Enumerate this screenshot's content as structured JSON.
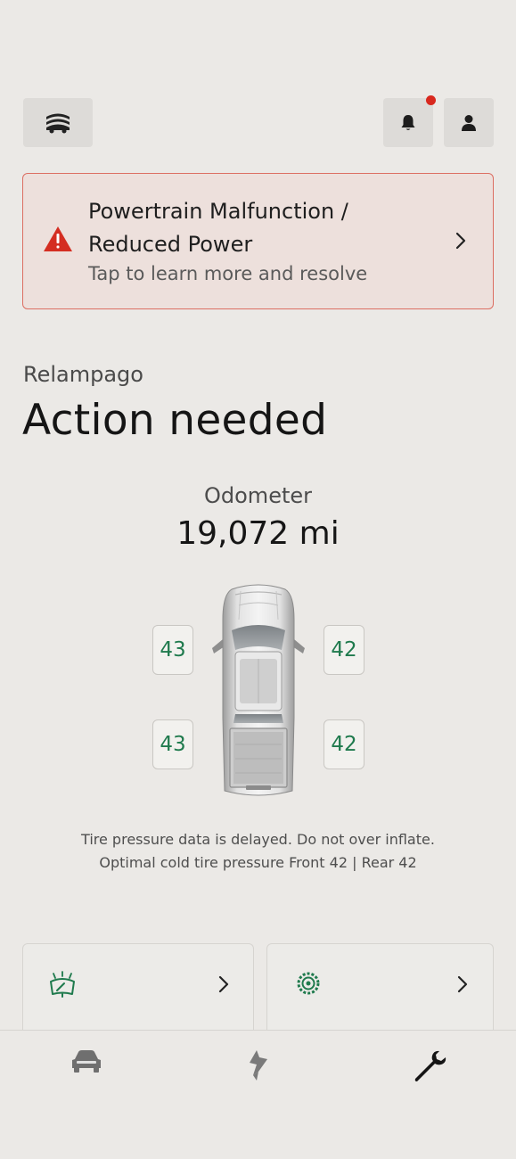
{
  "header": {
    "menu_icon": "garage-stack-icon",
    "bell_icon": "bell-icon",
    "user_icon": "person-icon",
    "notification_dot_color": "#d8281e"
  },
  "alert": {
    "title": "Powertrain Malfunction / Reduced Power",
    "subtitle": "Tap to learn more and resolve",
    "icon": "warning-triangle-icon",
    "icon_color": "#d42e22"
  },
  "vehicle": {
    "name": "Relampago",
    "status": "Action needed"
  },
  "odometer": {
    "label": "Odometer",
    "value": "19,072 mi"
  },
  "tires": {
    "front_left": "43",
    "front_right": "42",
    "rear_left": "43",
    "rear_right": "42",
    "value_color": "#1f7a4d"
  },
  "tire_note": {
    "line1": "Tire pressure data is delayed. Do not over inflate.",
    "line2": "Optimal cold tire pressure Front 42 | Rear 42"
  },
  "cards": [
    {
      "icon": "windshield-washer-icon"
    },
    {
      "icon": "tire-gear-icon"
    }
  ],
  "nav": [
    {
      "icon": "vehicle-icon"
    },
    {
      "icon": "charging-bolt-icon"
    },
    {
      "icon": "wrench-icon",
      "active": true
    }
  ]
}
